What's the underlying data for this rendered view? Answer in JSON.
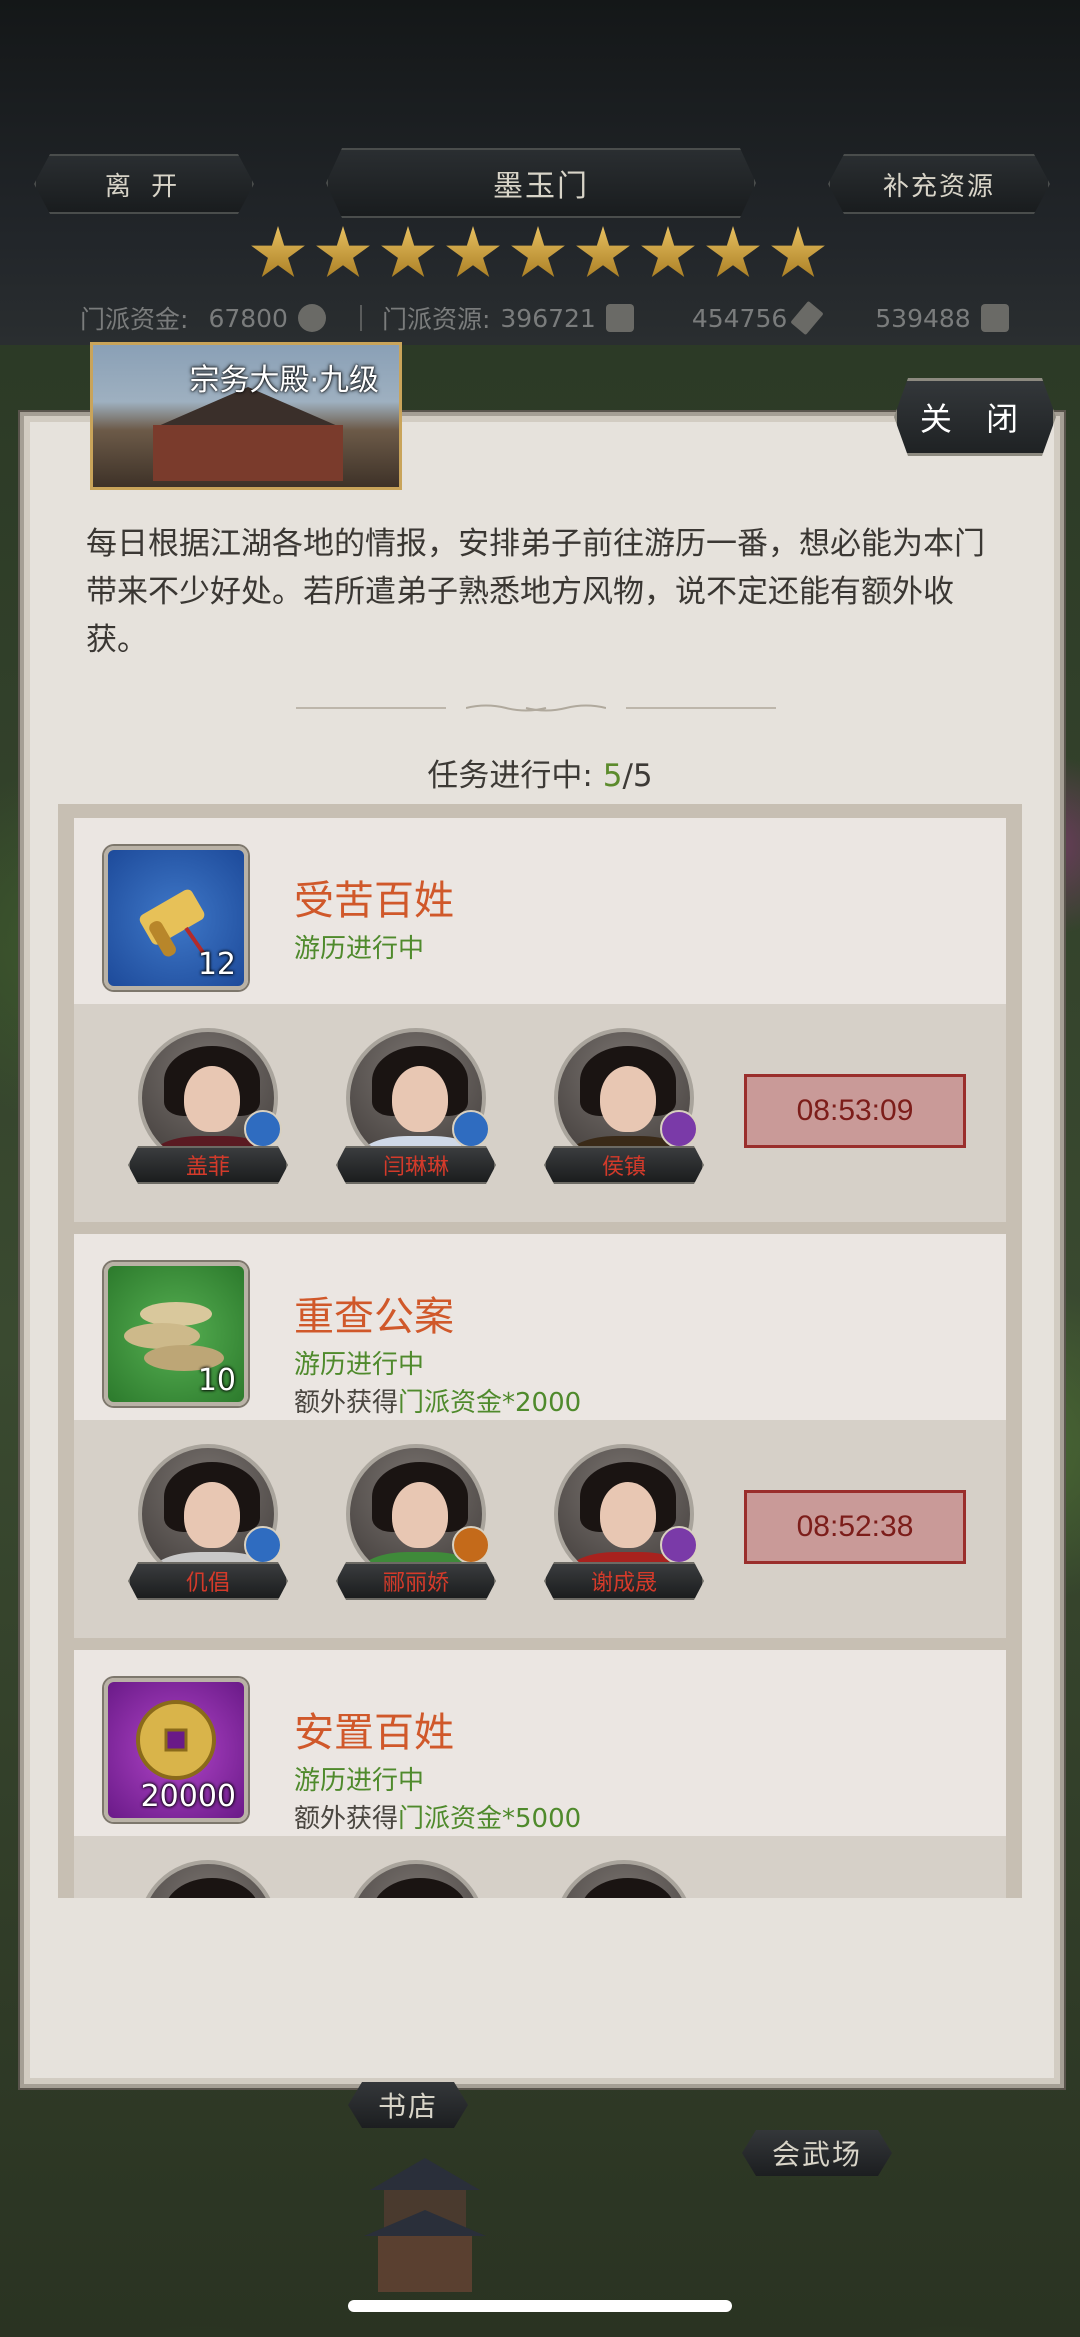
{
  "header": {
    "leave_label": "离 开",
    "title": "墨玉门",
    "replenish_label": "补充资源",
    "star_count": 9
  },
  "resources": {
    "fund_label": "门派资金:",
    "fund_value": "67800",
    "resource_label": "门派资源:",
    "resource_value": "396721",
    "item2_value": "454756",
    "item3_value": "539488"
  },
  "panel": {
    "building_label": "宗务大殿·九级",
    "close_label": "关 闭",
    "description": "每日根据江湖各地的情报，安排弟子前往游历一番，想必能为本门带来不少好处。若所遣弟子熟悉地方风物，说不定还能有额外收获。",
    "progress_label": "任务进行中:",
    "progress_current": "5",
    "progress_total": "/5"
  },
  "tasks": [
    {
      "title": "受苦百姓",
      "status": "游历进行中",
      "reward_count": "12",
      "reward_icon": "scroll-icon",
      "reward_color": "#2a5fb0",
      "extra_prefix": "",
      "extra_highlight": "",
      "heroes": [
        "盖菲",
        "闫琳琳",
        "侯镇"
      ],
      "timer": "08:53:09"
    },
    {
      "title": "重查公案",
      "status": "游历进行中",
      "reward_count": "10",
      "reward_icon": "cloth-bundle-icon",
      "reward_color": "#3a913a",
      "extra_prefix": "额外获得",
      "extra_highlight": "门派资金*2000",
      "heroes": [
        "仉倡",
        "郦丽娇",
        "谢成晟"
      ],
      "timer": "08:52:38"
    },
    {
      "title": "安置百姓",
      "status": "游历进行中",
      "reward_count": "20000",
      "reward_icon": "coin-icon",
      "reward_color": "#8a2aa8",
      "extra_prefix": "额外获得",
      "extra_highlight": "门派资金*5000",
      "heroes": [],
      "timer": ""
    }
  ],
  "world": {
    "bookstore_label": "书店",
    "arena_label": "会武场"
  }
}
